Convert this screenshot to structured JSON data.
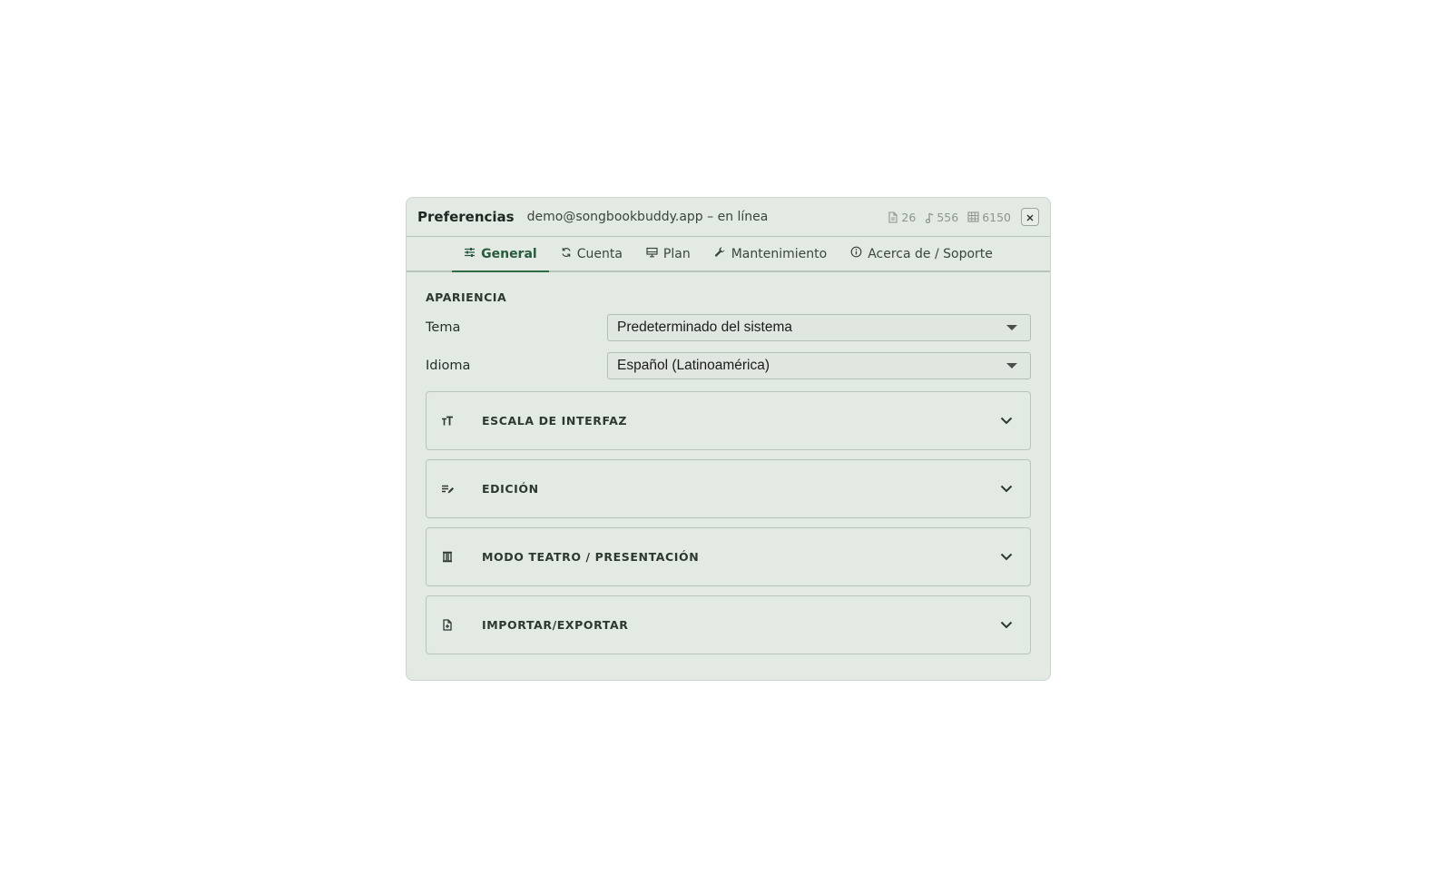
{
  "header": {
    "title": "Preferencias",
    "account": "demo@songbookbuddy.app – en línea",
    "stats": [
      {
        "icon": "document-icon",
        "value": "26"
      },
      {
        "icon": "music-note-icon",
        "value": "556"
      },
      {
        "icon": "grid-icon",
        "value": "6150"
      }
    ]
  },
  "tabs": [
    {
      "label": "General",
      "icon": "sliders-icon",
      "active": true
    },
    {
      "label": "Cuenta",
      "icon": "sync-icon",
      "active": false
    },
    {
      "label": "Plan",
      "icon": "monitor-icon",
      "active": false
    },
    {
      "label": "Mantenimiento",
      "icon": "wrench-icon",
      "active": false
    },
    {
      "label": "Acerca de / Soporte",
      "icon": "info-icon",
      "active": false
    }
  ],
  "appearance": {
    "section_title": "APARIENCIA",
    "theme_label": "Tema",
    "theme_value": "Predeterminado del sistema",
    "language_label": "Idioma",
    "language_value": "Español (Latinoamérica)"
  },
  "panels": [
    {
      "label": "ESCALA DE INTERFAZ",
      "icon": "text-size-icon"
    },
    {
      "label": "EDICIÓN",
      "icon": "edit-text-icon"
    },
    {
      "label": "MODO TEATRO / PRESENTACIÓN",
      "icon": "theater-icon"
    },
    {
      "label": "IMPORTAR/EXPORTAR",
      "icon": "file-import-icon"
    }
  ],
  "colors": {
    "accent": "#2f6b47",
    "background": "#e3e9e3"
  }
}
